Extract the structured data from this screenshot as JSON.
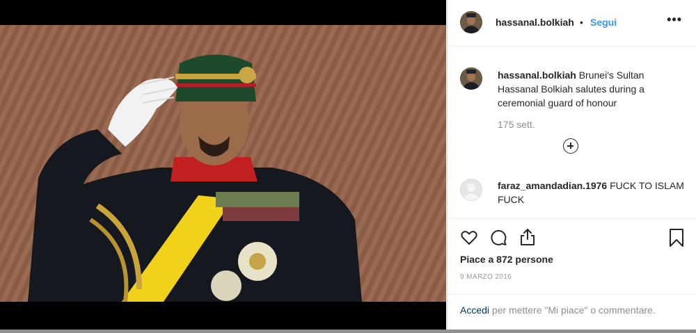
{
  "post": {
    "username": "hassanal.bolkiah",
    "separator": "•",
    "follow_label": "Segui",
    "more_label": "•••",
    "caption_user": "hassanal.bolkiah",
    "caption_text": "Brunei's Sultan Hassanal Bolkiah salutes during a ceremonial guard of honour",
    "age": "175 sett.",
    "comment_user": "faraz_amandadian.1976",
    "comment_text": "FUCK TO ISLAM FUCK",
    "likes": "Piace a 872 persone",
    "date": "9 MARZO 2016",
    "login_link": "Accedi",
    "login_text": "per mettere \"Mi piace\" o commentare."
  },
  "icons": {
    "like": "heart-icon",
    "comment": "comment-bubble-icon",
    "share": "share-icon",
    "save": "bookmark-icon",
    "load_more": "plus-circle-icon"
  },
  "colors": {
    "follow": "#3897f0",
    "muted": "#8e8e8e",
    "link": "#003569"
  }
}
